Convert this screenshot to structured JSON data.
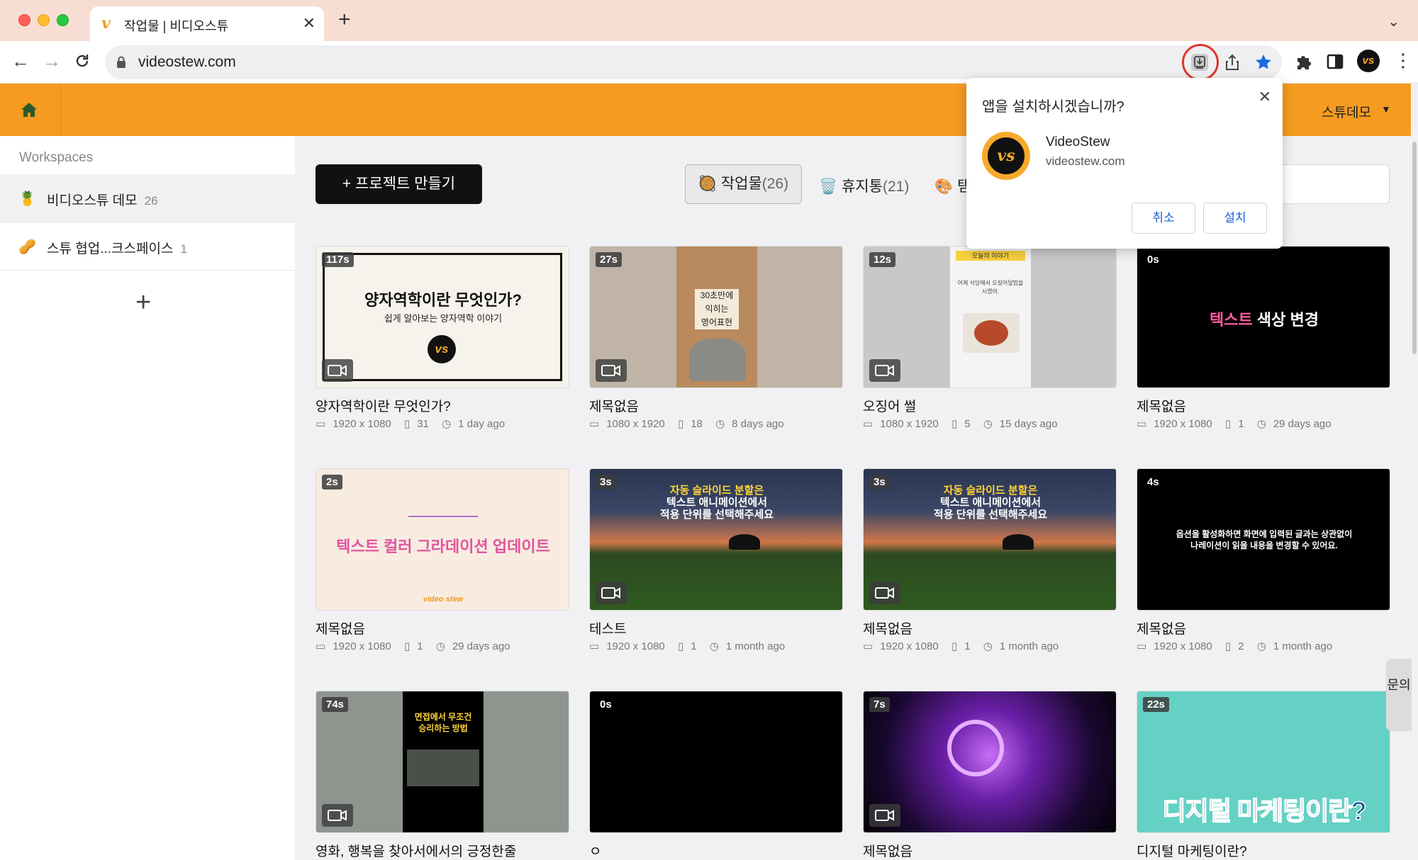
{
  "browser": {
    "tab_title": "작업물 | 비디오스튜",
    "url": "videostew.com"
  },
  "header": {
    "user_name": "스튜데모"
  },
  "sidebar": {
    "section_label": "Workspaces",
    "items": [
      {
        "emoji": "🍍",
        "label": "비디오스튜 데모",
        "count": "26"
      },
      {
        "emoji": "🥜",
        "label": "스튜 협업...크스페이스",
        "count": "1"
      }
    ]
  },
  "toolbar": {
    "create_label": "+ 프로젝트 만들기",
    "filters": [
      {
        "emoji": "🥘",
        "label": "작업물",
        "count": "(26)"
      },
      {
        "emoji": "🗑️",
        "label": "휴지통",
        "count": "(21)"
      },
      {
        "emoji": "🎨",
        "label": "탬"
      }
    ]
  },
  "popup": {
    "title": "앱을 설치하시겠습니까?",
    "app_name": "VideoStew",
    "app_domain": "videostew.com",
    "logo_text": "vs",
    "cancel_label": "취소",
    "install_label": "설치"
  },
  "inquiry_label": "문의",
  "cards": [
    {
      "duration": "117s",
      "title": "양자역학이란 무엇인가?",
      "resolution": "1920 x 1080",
      "pages": "31",
      "time": "1 day ago",
      "thumb_title": "양자역학이란 무엇인가?",
      "thumb_sub": "쉽게 알아보는 양자역학 이야기"
    },
    {
      "duration": "27s",
      "title": "제목없음",
      "resolution": "1080 x 1920",
      "pages": "18",
      "time": "8 days ago",
      "thumb_lines": [
        "30초만에",
        "익히는",
        "영어표현"
      ]
    },
    {
      "duration": "12s",
      "title": "오징어 썰",
      "resolution": "1080 x 1920",
      "pages": "5",
      "time": "15 days ago",
      "thumb_top": "오늘의 이야기",
      "thumb_body": "어제 식당에서 오징어덮밥을 시켰어."
    },
    {
      "duration": "0s",
      "title": "제목없음",
      "resolution": "1920 x 1080",
      "pages": "1",
      "time": "29 days ago",
      "thumb_a": "텍스트",
      "thumb_b": " 색상 변경"
    },
    {
      "duration": "2s",
      "title": "제목없음",
      "resolution": "1920 x 1080",
      "pages": "1",
      "time": "29 days ago",
      "thumb_main": "텍스트 컬러 그라데이션 업데이트",
      "thumb_logo": "video stew"
    },
    {
      "duration": "3s",
      "title": "테스트",
      "resolution": "1920 x 1080",
      "pages": "1",
      "time": "1 month ago",
      "thumb_l1": "자동 슬라이드 분할은",
      "thumb_l2": "텍스트 애니메이션에서",
      "thumb_l3": "적용 단위를 선택해주세요"
    },
    {
      "duration": "3s",
      "title": "제목없음",
      "resolution": "1920 x 1080",
      "pages": "1",
      "time": "1 month ago",
      "thumb_l1": "자동 슬라이드 분할은",
      "thumb_l2": "텍스트 애니메이션에서",
      "thumb_l3": "적용 단위를 선택해주세요"
    },
    {
      "duration": "4s",
      "title": "제목없음",
      "resolution": "1920 x 1080",
      "pages": "2",
      "time": "1 month ago",
      "thumb_l1": "옵션을 활성화하면 화면에 입력된 글과는 상관없이",
      "thumb_l2": "나레이션이 읽을 내용을 변경할 수 있어요."
    },
    {
      "duration": "74s",
      "title": "영화, 행복을 찾아서에서의 긍정한줄",
      "thumb_l1": "면접에서 무조건",
      "thumb_l2": "승리하는 방법"
    },
    {
      "duration": "0s",
      "title": "ㅇ"
    },
    {
      "duration": "7s",
      "title": "제목없음"
    },
    {
      "duration": "22s",
      "title": "디지털 마케팅이란?",
      "thumb_main": "디지털 마케팅이란?"
    }
  ],
  "colors": {
    "brand_orange": "#f59b20",
    "install_ring": "#e2332a",
    "popup_button_text": "#1a5fd6"
  }
}
